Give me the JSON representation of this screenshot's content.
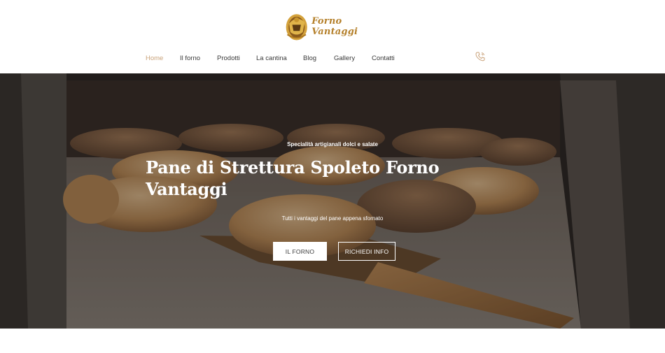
{
  "brand": {
    "name": "Forno Vantaggi",
    "accent": "#c9a27a",
    "logo_color": "#b5812c"
  },
  "nav": {
    "items": [
      {
        "label": "Home",
        "active": true
      },
      {
        "label": "Il forno",
        "active": false
      },
      {
        "label": "Prodotti",
        "active": false
      },
      {
        "label": "La cantina",
        "active": false
      },
      {
        "label": "Blog",
        "active": false
      },
      {
        "label": "Gallery",
        "active": false
      },
      {
        "label": "Contatti",
        "active": false
      }
    ],
    "phone_icon": "phone-icon"
  },
  "hero": {
    "eyebrow": "Specialità artigianali dolci e salate",
    "title": "Pane di Strettura Spoleto Forno Vantaggi",
    "subtitle": "Tutti i vantaggi del pane appena sfornato",
    "primary_button": "IL FORNO",
    "secondary_button": "RICHIEDI INFO",
    "image": "bread-in-oven-photo"
  }
}
